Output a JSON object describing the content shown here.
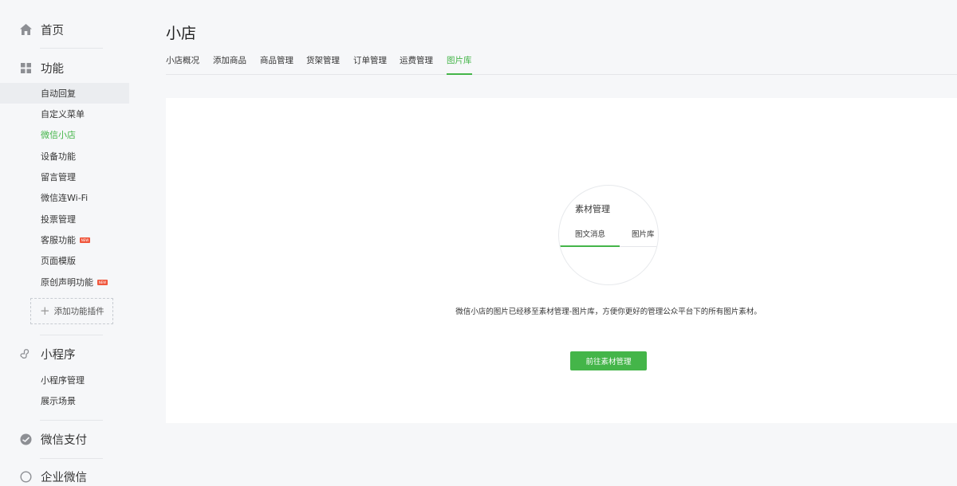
{
  "sidebar": {
    "home_label": "首页",
    "features_label": "功能",
    "feature_items": [
      "自动回复",
      "自定义菜单",
      "微信小店",
      "设备功能",
      "留言管理",
      "微信连Wi-Fi",
      "投票管理",
      "客服功能",
      "页面模版",
      "原创声明功能"
    ],
    "new_badge": "NEW",
    "add_plugin_label": "添加功能插件",
    "miniprogram_label": "小程序",
    "miniprogram_items": [
      "小程序管理",
      "展示场景"
    ],
    "pay_label": "微信支付",
    "wecom_label": "企业微信"
  },
  "main": {
    "title": "小店",
    "tabs": [
      "小店概况",
      "添加商品",
      "商品管理",
      "货架管理",
      "订单管理",
      "运费管理",
      "图片库"
    ],
    "active_tab": "图片库",
    "illustration": {
      "title": "素材管理",
      "tab_news": "图文消息",
      "tab_images": "图片库"
    },
    "notice": "微信小店的图片已经移至素材管理-图片库，方便你更好的管理公众平台下的所有图片素材。",
    "button_label": "前往素材管理"
  },
  "colors": {
    "accent": "#44b549",
    "badge": "#f0573d"
  }
}
